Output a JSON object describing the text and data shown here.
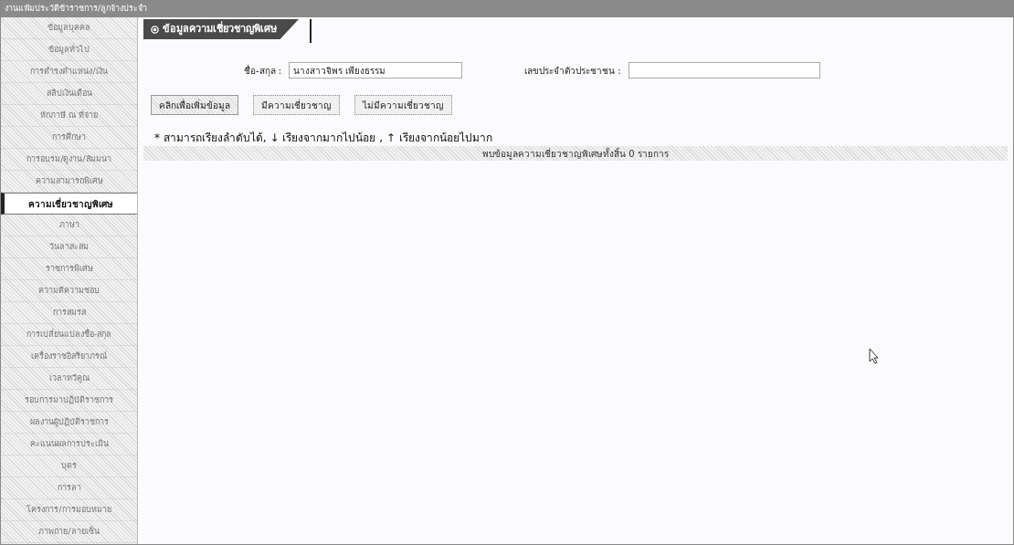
{
  "window": {
    "title": "งานแฟ้มประวัติข้าราชการ/ลูกจ้างประจำ"
  },
  "sidebar": {
    "items": [
      {
        "label": "ข้อมูลบุคคล",
        "selected": false
      },
      {
        "label": "ข้อมูลทั่วไป",
        "selected": false
      },
      {
        "label": "การดำรงตำแหน่ง/เงิน",
        "selected": false
      },
      {
        "label": "สลิปเงินเดือน",
        "selected": false
      },
      {
        "label": "หักภาษี ณ ที่จ่าย",
        "selected": false
      },
      {
        "label": "การศึกษา",
        "selected": false
      },
      {
        "label": "การอบรม/ดูงาน/สัมมนา",
        "selected": false
      },
      {
        "label": "ความสามารถพิเศษ",
        "selected": false
      },
      {
        "label": "ความเชี่ยวชาญพิเศษ",
        "selected": true
      },
      {
        "label": "ภาษา",
        "selected": false
      },
      {
        "label": "วันลาสะสม",
        "selected": false
      },
      {
        "label": "ราชการพิเศษ",
        "selected": false
      },
      {
        "label": "ความดีความชอบ",
        "selected": false
      },
      {
        "label": "การสมรส",
        "selected": false
      },
      {
        "label": "การเปลี่ยนแปลงชื่อ-สกุล",
        "selected": false
      },
      {
        "label": "เครื่องราชอิสริยาภรณ์",
        "selected": false
      },
      {
        "label": "เวลาทวีคูณ",
        "selected": false
      },
      {
        "label": "รอบการมาปฏิบัติราชการ",
        "selected": false
      },
      {
        "label": "ผลงานผู้ปฏิบัติราชการ",
        "selected": false
      },
      {
        "label": "คะแนนผลการประเมิน",
        "selected": false
      },
      {
        "label": "บุตร",
        "selected": false
      },
      {
        "label": "การลา",
        "selected": false
      },
      {
        "label": "โครงการ/การมอบหมาย",
        "selected": false
      },
      {
        "label": "ภาพถ่าย/ลายเซ็น",
        "selected": false
      }
    ]
  },
  "section": {
    "title": "ข้อมูลความเชี่ยวชาญพิเศษ"
  },
  "form": {
    "fields": [
      {
        "label": "ชื่อ-สกุล :",
        "value": "นางสาวจิพร เพียงธรรม"
      },
      {
        "label": "เลขประจำตัวประชาชน :"
      }
    ]
  },
  "buttons": [
    "คลิกเพื่อเพิ่มข้อมูล",
    "มีความเชี่ยวชาญ",
    "ไม่มีความเชี่ยวชาญ"
  ],
  "sort_note": "* สามารถเรียงลำดับได้, ↓ เรียงจากมากไปน้อย , ↑ เรียงจากน้อยไปมาก",
  "result_bar": "พบข้อมูลความเชี่ยวชาญพิเศษทั้งสิ้น 0 รายการ"
}
